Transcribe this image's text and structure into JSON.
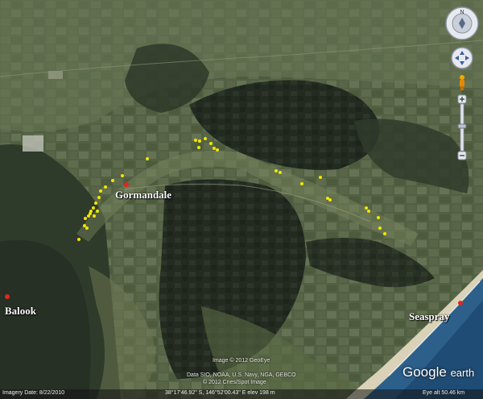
{
  "places": {
    "gormandale": "Gormandale",
    "balook": "Balook",
    "seaspray": "Seaspray"
  },
  "credits": {
    "image_credit": "Image © 2012 GeoEye",
    "data_credit": "Data SIO, NOAA, U.S. Navy, NGA, GEBCO",
    "spot_credit": "© 2012 Cnes/Spot Image"
  },
  "status_bar": {
    "imagery_date": "Imagery Date: 8/22/2010",
    "coordinates": "38°17'46.92\" S, 146°52'00.43\" E  elev  198 m",
    "eye_alt": "Eye alt   50.46 km"
  },
  "logo": {
    "google": "Google",
    "earth": "earth"
  },
  "colors": {
    "marker_red": "#e0281e",
    "point_yellow": "#f2e600",
    "ocean": "#2c5f8a",
    "beach": "#d9d2b8"
  },
  "icons": [
    "compass-icon",
    "look-joystick-icon",
    "pegman-icon",
    "zoom-in-icon",
    "zoom-out-icon"
  ]
}
